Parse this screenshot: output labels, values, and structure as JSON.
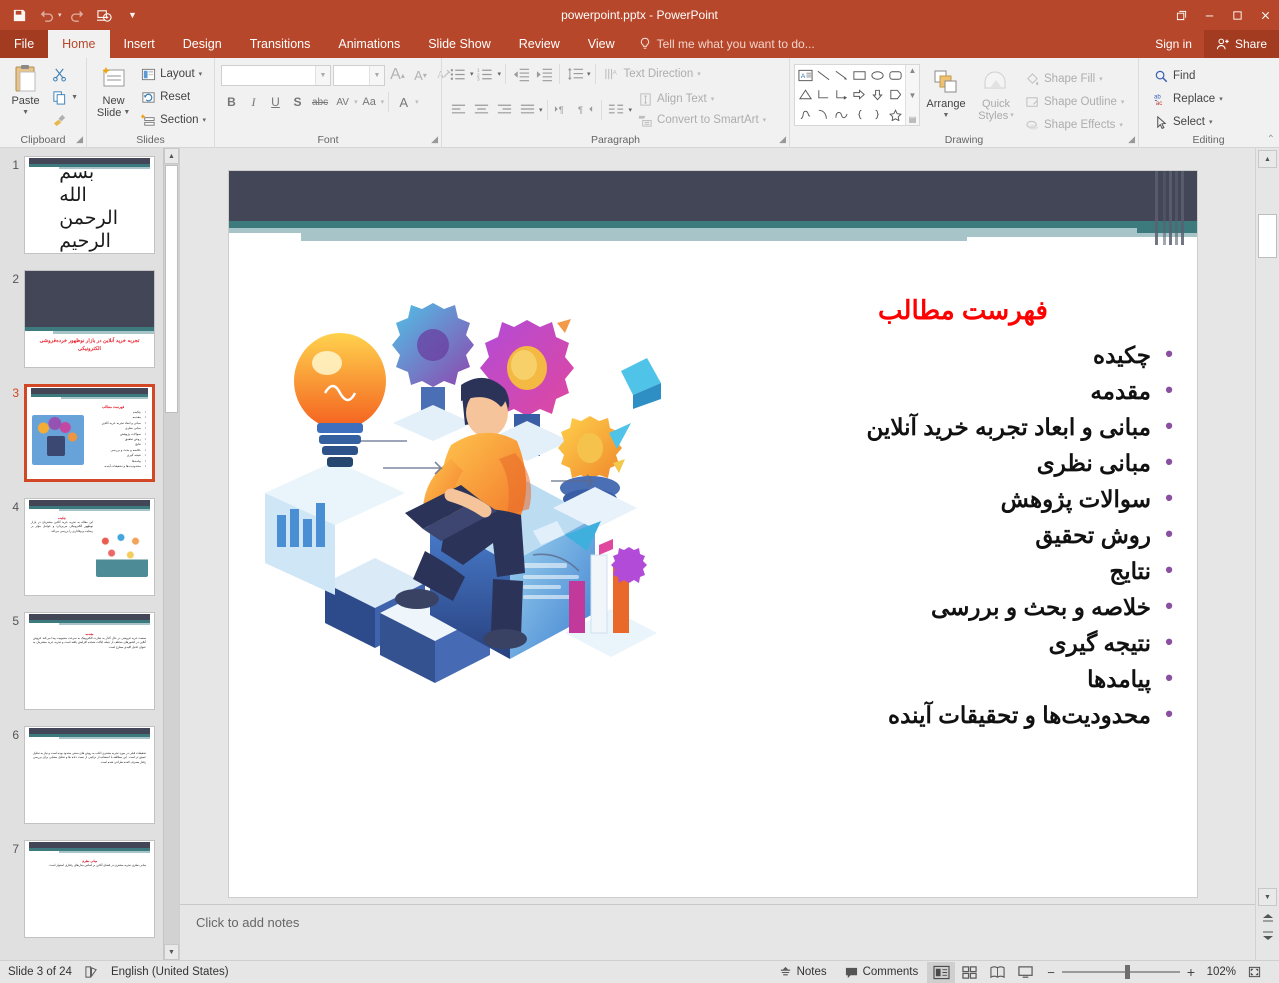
{
  "window": {
    "title": "powerpoint.pptx - PowerPoint",
    "quick_access": [
      {
        "name": "save",
        "icon": "save-icon"
      },
      {
        "name": "undo",
        "icon": "undo-icon"
      },
      {
        "name": "redo",
        "icon": "redo-icon"
      },
      {
        "name": "start-presentation",
        "icon": "present-icon"
      },
      {
        "name": "customize-qat",
        "icon": "chevron-down-icon"
      }
    ],
    "controls": {
      "restore": "❐",
      "minimize": "─",
      "maximize": "☐",
      "close": "✕"
    }
  },
  "tabs": [
    {
      "label": "File",
      "active": false,
      "file": true
    },
    {
      "label": "Home",
      "active": true
    },
    {
      "label": "Insert",
      "active": false
    },
    {
      "label": "Design",
      "active": false
    },
    {
      "label": "Transitions",
      "active": false
    },
    {
      "label": "Animations",
      "active": false
    },
    {
      "label": "Slide Show",
      "active": false
    },
    {
      "label": "Review",
      "active": false
    },
    {
      "label": "View",
      "active": false
    }
  ],
  "tellme": "Tell me what you want to do...",
  "account": {
    "signin": "Sign in",
    "share": "Share"
  },
  "ribbon": {
    "clipboard": {
      "label": "Clipboard",
      "paste": "Paste",
      "cut": "Cut",
      "copy": "Copy",
      "format_painter": "Format Painter"
    },
    "slides": {
      "label": "Slides",
      "new_slide": "New\nSlide",
      "new_slide_line1": "New",
      "new_slide_line2": "Slide",
      "layout": "Layout",
      "reset": "Reset",
      "section": "Section"
    },
    "font": {
      "label": "Font",
      "font_name": "",
      "font_name_placeholder": "",
      "font_size": "",
      "grow": "A",
      "shrink": "A",
      "clear_formatting": "Clear All Formatting",
      "bold": "B",
      "italic": "I",
      "underline": "U",
      "shadow": "S",
      "strikethrough": "abc",
      "character_spacing": "AV",
      "change_case": "Aa",
      "font_color": "A"
    },
    "paragraph": {
      "label": "Paragraph",
      "text_direction": "Text Direction",
      "align_text": "Align Text",
      "convert_to_smartart": "Convert to SmartArt"
    },
    "drawing": {
      "label": "Drawing",
      "arrange": "Arrange",
      "quick_styles_line1": "Quick",
      "quick_styles_line2": "Styles",
      "shape_fill": "Shape Fill",
      "shape_outline": "Shape Outline",
      "shape_effects": "Shape Effects"
    },
    "editing": {
      "label": "Editing",
      "find": "Find",
      "replace": "Replace",
      "select": "Select"
    }
  },
  "thumbnails": [
    {
      "number": "1",
      "type": "bismillah",
      "text": "بسم الله الرحمن الرحیم",
      "selected": false
    },
    {
      "number": "2",
      "type": "title",
      "text": "تجربه خرید آنلاین در بازار نوظهور خرده‌فروشی الکترونیکی",
      "selected": false
    },
    {
      "number": "3",
      "type": "toc",
      "selected": true
    },
    {
      "number": "4",
      "type": "text-image",
      "title": "چکیده",
      "selected": false
    },
    {
      "number": "5",
      "type": "text",
      "title": "مقدمه",
      "selected": false
    },
    {
      "number": "6",
      "type": "text",
      "title": "",
      "selected": false
    },
    {
      "number": "7",
      "type": "text",
      "title": "مبانی نظری",
      "selected": false
    }
  ],
  "slide": {
    "toc_title": "فهرست مطالب",
    "items": [
      "چکیده",
      "مقدمه",
      "مبانی و ابعاد تجربه خرید آنلاین",
      "مبانی نظری",
      "سوالات پژوهش",
      "روش تحقیق",
      "نتایج",
      "خلاصه و بحث و بررسی",
      "نتیجه گیری",
      "پیامدها",
      "محدودیت‌ها و تحقیقات آینده"
    ],
    "colors": {
      "title": "#ff0000",
      "bullet": "#8a4fa0",
      "header_dark": "#424656",
      "header_teal": "#3d7a7e",
      "header_light": "#a7c4c9"
    }
  },
  "notes": {
    "placeholder": "Click to add notes"
  },
  "status": {
    "slide_count": "Slide 3 of 24",
    "language": "English (United States)",
    "notes": "Notes",
    "comments": "Comments",
    "zoom": "102%",
    "views": [
      {
        "name": "normal",
        "active": true
      },
      {
        "name": "slide-sorter",
        "active": false
      },
      {
        "name": "reading-view",
        "active": false
      },
      {
        "name": "slide-show",
        "active": false
      }
    ],
    "zoom_out": "−",
    "zoom_in": "+"
  }
}
